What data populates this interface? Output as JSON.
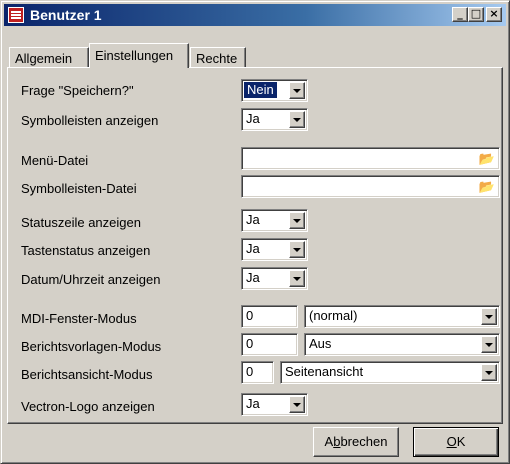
{
  "window": {
    "title": "Benutzer 1",
    "controls": {
      "minimize": "_",
      "maximize": "□",
      "close": "×"
    }
  },
  "tabs": [
    {
      "label": "Allgemein",
      "active": false
    },
    {
      "label": "Einstellungen",
      "active": true
    },
    {
      "label": "Rechte",
      "active": false
    }
  ],
  "settings": {
    "frage_speichern": {
      "label": "Frage \"Speichern?\"",
      "value": "Nein"
    },
    "symbolleisten_anzeigen": {
      "label": "Symbolleisten anzeigen",
      "value": "Ja"
    },
    "menue_datei": {
      "label": "Menü-Datei",
      "value": ""
    },
    "symbolleisten_datei": {
      "label": "Symbolleisten-Datei",
      "value": ""
    },
    "statuszeile": {
      "label": "Statuszeile anzeigen",
      "value": "Ja"
    },
    "tastenstatus": {
      "label": "Tastenstatus anzeigen",
      "value": "Ja"
    },
    "datum_uhrzeit": {
      "label": "Datum/Uhrzeit anzeigen",
      "value": "Ja"
    },
    "mdi_modus": {
      "label": "MDI-Fenster-Modus",
      "number": "0",
      "value": "(normal)"
    },
    "berichtsvorlagen_modus": {
      "label": "Berichtsvorlagen-Modus",
      "number": "0",
      "value": "Aus"
    },
    "berichtsansicht_modus": {
      "label": "Berichtsansicht-Modus",
      "number": "0",
      "value": "Seitenansicht"
    },
    "vectron_logo": {
      "label": "Vectron-Logo anzeigen",
      "value": "Ja"
    }
  },
  "buttons": {
    "cancel_prefix": "A",
    "cancel_accel": "b",
    "cancel_rest": "brechen",
    "ok_accel": "O",
    "ok_rest": "K"
  },
  "icons": {
    "browse": "folder-open-icon",
    "dropdown": "chevron-down-icon"
  },
  "colors": {
    "titlebar_start": "#0a246a",
    "titlebar_end": "#a6caf0",
    "face": "#d4d0c8",
    "selection": "#0a246a"
  }
}
